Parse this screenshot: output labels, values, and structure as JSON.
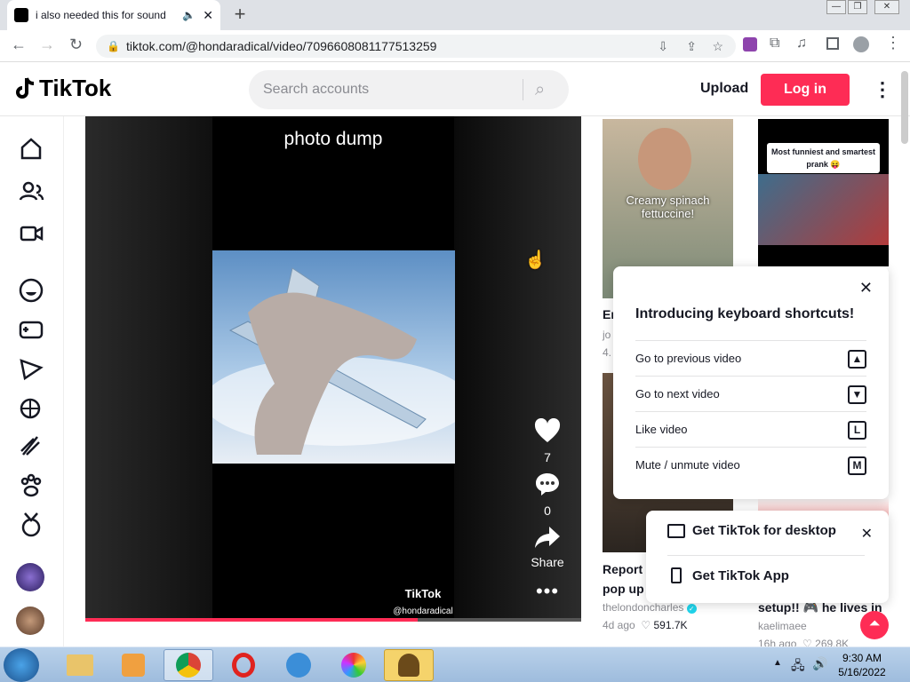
{
  "browser": {
    "tab_title": "i also needed this for sound",
    "url": "tiktok.com/@hondaradical/video/7096608081177513259"
  },
  "header": {
    "logo": "TikTok",
    "search_placeholder": "Search accounts",
    "upload": "Upload",
    "login": "Log in"
  },
  "video": {
    "caption": "photo dump",
    "likes": "7",
    "comments": "0",
    "share": "Share",
    "watermark": "TikTok",
    "watermark_user": "@hondaradical",
    "progress_fraction": 0.67
  },
  "recommended": [
    {
      "overlay": "Creamy spinach fettuccine!",
      "title": "Er",
      "user": "jo",
      "meta": "4."
    },
    {
      "overlay": "Most funniest and smartest prank 😝"
    },
    {
      "title": "Report c",
      "title2": "pop up",
      "user": "thelondoncharles",
      "age": "4d ago",
      "views": "591.7K"
    },
    {
      "title": "setup!! 🎮 he lives in...",
      "user": "kaelimaee",
      "age": "16h ago",
      "views": "269.8K"
    }
  ],
  "shortcuts": {
    "title": "Introducing keyboard shortcuts!",
    "items": [
      {
        "label": "Go to previous video",
        "key": "▲"
      },
      {
        "label": "Go to next video",
        "key": "▼"
      },
      {
        "label": "Like video",
        "key": "L"
      },
      {
        "label": "Mute / unmute video",
        "key": "M"
      }
    ]
  },
  "get_app": {
    "desktop": "Get TikTok for desktop",
    "app": "Get TikTok App"
  },
  "taskbar": {
    "time": "9:30 AM",
    "date": "5/16/2022"
  },
  "colors": {
    "brand": "#fe2c55",
    "verified": "#20d5ec"
  }
}
